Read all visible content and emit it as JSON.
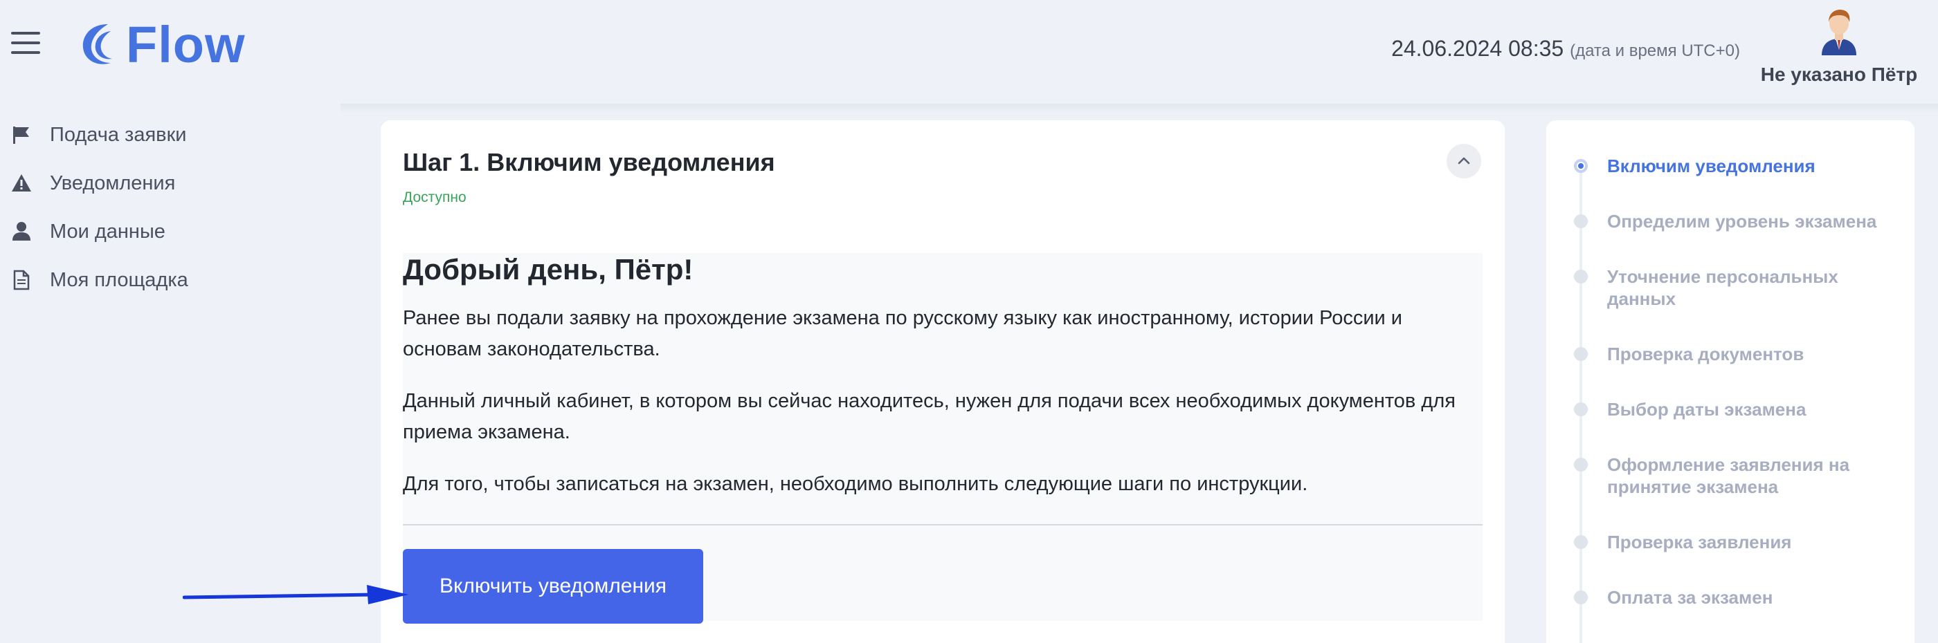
{
  "header": {
    "menu_icon": "hamburger-menu-icon",
    "logo_text": "Flow",
    "logo_icon": "crescent-wave-icon",
    "datetime": "24.06.2024 08:35",
    "timezone_note": "(дата и время UTC+0)",
    "user_name": "Не указано Пётр",
    "avatar_icon": "user-avatar-icon"
  },
  "sidebar": {
    "items": [
      {
        "label": "Подача заявки",
        "icon": "flag-icon"
      },
      {
        "label": "Уведомления",
        "icon": "warning-icon"
      },
      {
        "label": "Мои данные",
        "icon": "user-icon"
      },
      {
        "label": "Моя площадка",
        "icon": "document-icon"
      }
    ]
  },
  "main": {
    "step_title": "Шаг 1. Включим уведомления",
    "status": "Доступно",
    "collapse_icon": "chevron-up-icon",
    "greeting": "Добрый день, Пётр!",
    "paragraphs": [
      "Ранее вы подали заявку на прохождение экзамена по русскому языку как иностранному, истории России и основам законодательства.",
      "Данный личный кабинет, в котором вы сейчас находитесь, нужен для подачи всех необходимых документов для приема экзамена.",
      "Для того, чтобы записаться на экзамен, необходимо выполнить следующие шаги по инструкции."
    ],
    "button_label": "Включить уведомления"
  },
  "stepper": {
    "active_index": 0,
    "steps": [
      {
        "label": "Включим уведомления"
      },
      {
        "label": "Определим уровень экзамена"
      },
      {
        "label": "Уточнение персональных данных"
      },
      {
        "label": "Проверка документов"
      },
      {
        "label": "Выбор даты экзамена"
      },
      {
        "label": "Оформление заявления на принятие экзамена"
      },
      {
        "label": "Проверка заявления"
      },
      {
        "label": "Оплата за экзамен"
      }
    ]
  },
  "colors": {
    "brand": "#4573e0",
    "button": "#4565e8",
    "status_green": "#3aa45a",
    "background": "#eef1f8",
    "arrow": "#1536d8"
  }
}
